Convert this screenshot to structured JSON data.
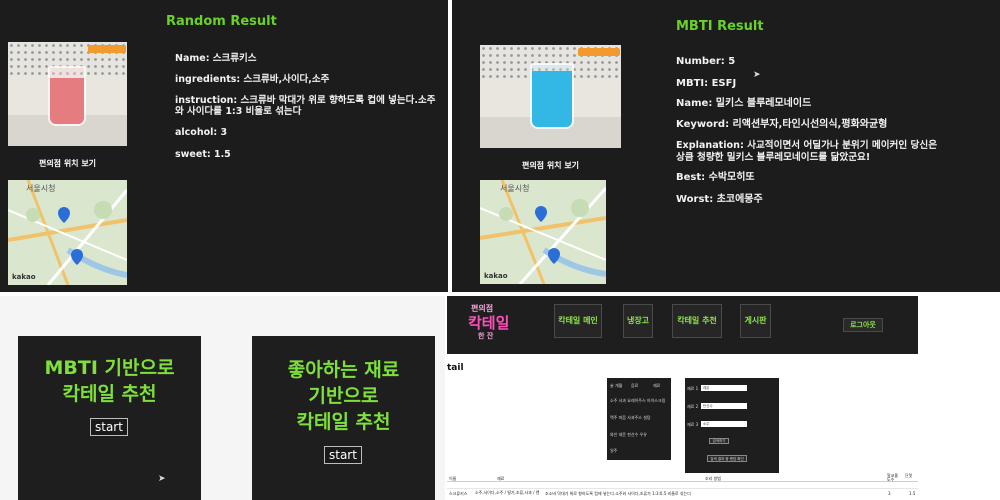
{
  "random_panel": {
    "title": "Random Result",
    "see_store": "편의점 위치 보기",
    "map_place": "서울시청",
    "map_brand": "kakao",
    "fields": {
      "name": "Name: 스크류키스",
      "ingredients": "ingredients: 스크류바,사이다,소주",
      "instruction_line1": "instruction: 스크류바 막대가 위로 향하도록 컵에 넣는다.소주",
      "instruction_line2": "와 사이다를 1:3 비율로 섞는다",
      "alcohol": "alcohol: 3",
      "sweet": "sweet: 1.5"
    }
  },
  "mbti_panel": {
    "title": "MBTI Result",
    "see_store": "편의점 위치 보기",
    "map_place": "서울시청",
    "map_brand": "kakao",
    "fields": {
      "number": "Number: 5",
      "mbti": "MBTI: ESFJ",
      "name": "Name: 밀키스 블루레모네이드",
      "keyword": "Keyword: 리액션부자,타인시선의식,평화와균형",
      "explanation_line1": "Explanation: 사교적이면서 어딜가나 분위기 메이커인 당신은",
      "explanation_line2": "상큼 청량한 밀키스 블루레모네이드를 닮았군요!",
      "best": "Best: 수박모히또",
      "worst": "Worst: 초코에몽주"
    }
  },
  "recommend_cards": [
    {
      "title_line1": "MBTI 기반으로",
      "title_line2": "칵테일 추천",
      "title_line3": "",
      "button": "start"
    },
    {
      "title_line1": "좋아하는 재료",
      "title_line2": "기반으로",
      "title_line3": "칵테일 추천",
      "button": "start"
    }
  ],
  "site": {
    "logo_line1": "편의점",
    "logo_line2": "칵테일",
    "logo_line3": "한 잔",
    "nav": [
      "칵테일 메인",
      "냉장고",
      "칵테일 추천",
      "게시판"
    ],
    "logout": "로그아웃",
    "page_label": "tail",
    "ingredients_box": {
      "row1": [
        "술 개월",
        "음료",
        "재료"
      ],
      "row2": "소주 사과 요레이주스 아이스크림",
      "row3": "맥주 마음 사과주스  설탕",
      "row4": "와인 데운 판산수  우유",
      "row5": "일주"
    },
    "search_box": {
      "label1": "재료 1",
      "label2": "재료 2",
      "label3": "재료 3",
      "value1": "레몬",
      "value2": "탄산수",
      "value3": "소주",
      "search_button": "검색하기",
      "list_button": "검색 결과 중 랜덤 확인"
    },
    "table": {
      "headers": [
        "이름",
        "재료",
        "조리 방법",
        "알코올 도수",
        "단맛"
      ],
      "row": [
        "스크류키스",
        "소주,사이다,소주 / 딸기,조류,사과 / 캔",
        "조소바 막대가 위로 향하도록 컵에 넣는다.소주와 사이다,조류가 1:3:0.5 비율로 섞는다",
        "3",
        "1.5"
      ]
    }
  },
  "colors": {
    "accent_green": "#6ad12a",
    "logo_pink": "#ff4fb8",
    "panel_dark": "#1c1c1c"
  }
}
